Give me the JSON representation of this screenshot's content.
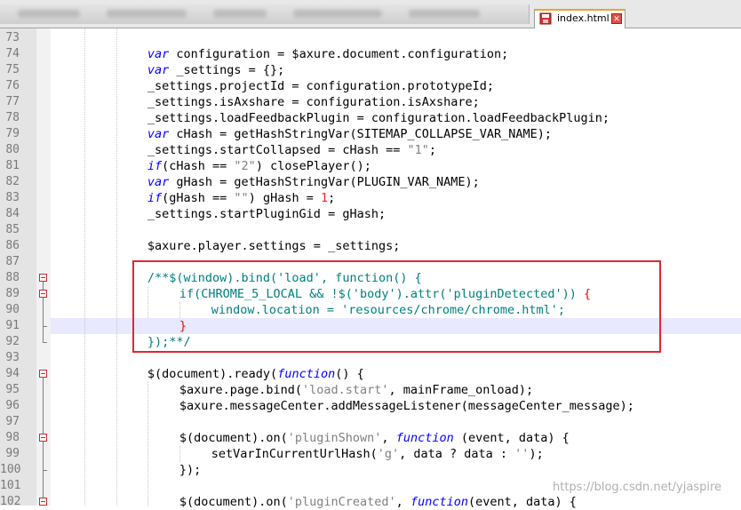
{
  "tab": {
    "filename": "index.html",
    "close_symbol": "✕"
  },
  "editor": {
    "lines": [
      {
        "num": "73",
        "indent": 0,
        "tokens": []
      },
      {
        "num": "74",
        "indent": 12,
        "tokens": [
          {
            "t": "var",
            "c": "kw"
          },
          {
            "t": " configuration = $axure.document.configuration;"
          }
        ]
      },
      {
        "num": "75",
        "indent": 12,
        "tokens": [
          {
            "t": "var",
            "c": "kw"
          },
          {
            "t": " _settings = {};"
          }
        ]
      },
      {
        "num": "76",
        "indent": 12,
        "tokens": [
          {
            "t": "_settings.projectId = configuration.prototypeId;"
          }
        ]
      },
      {
        "num": "77",
        "indent": 12,
        "tokens": [
          {
            "t": "_settings.isAxshare = configuration.isAxshare;"
          }
        ]
      },
      {
        "num": "78",
        "indent": 12,
        "tokens": [
          {
            "t": "_settings.loadFeedbackPlugin = configuration.loadFeedbackPlugin;"
          }
        ]
      },
      {
        "num": "79",
        "indent": 12,
        "tokens": [
          {
            "t": "var",
            "c": "kw"
          },
          {
            "t": " cHash = getHashStringVar(SITEMAP_COLLAPSE_VAR_NAME);"
          }
        ]
      },
      {
        "num": "80",
        "indent": 12,
        "tokens": [
          {
            "t": "_settings.startCollapsed = cHash == "
          },
          {
            "t": "\"1\"",
            "c": "str"
          },
          {
            "t": ";"
          }
        ]
      },
      {
        "num": "81",
        "indent": 12,
        "tokens": [
          {
            "t": "if",
            "c": "kw"
          },
          {
            "t": "(cHash == "
          },
          {
            "t": "\"2\"",
            "c": "str"
          },
          {
            "t": ") closePlayer();"
          }
        ]
      },
      {
        "num": "82",
        "indent": 12,
        "tokens": [
          {
            "t": "var",
            "c": "kw"
          },
          {
            "t": " gHash = getHashStringVar(PLUGIN_VAR_NAME);"
          }
        ]
      },
      {
        "num": "83",
        "indent": 12,
        "tokens": [
          {
            "t": "if",
            "c": "kw"
          },
          {
            "t": "(gHash == "
          },
          {
            "t": "\"\"",
            "c": "str"
          },
          {
            "t": ") gHash = "
          },
          {
            "t": "1",
            "c": "num"
          },
          {
            "t": ";"
          }
        ]
      },
      {
        "num": "84",
        "indent": 12,
        "tokens": [
          {
            "t": "_settings.startPluginGid = gHash;"
          }
        ]
      },
      {
        "num": "85",
        "indent": 0,
        "tokens": []
      },
      {
        "num": "86",
        "indent": 12,
        "tokens": [
          {
            "t": "$axure.player.settings = _settings;"
          }
        ]
      },
      {
        "num": "87",
        "indent": 0,
        "tokens": []
      },
      {
        "num": "88",
        "indent": 12,
        "tokens": [
          {
            "t": "/**$(window).bind('load', function() {",
            "c": "cmt"
          }
        ]
      },
      {
        "num": "89",
        "indent": 16,
        "tokens": [
          {
            "t": "if(CHROME_5_LOCAL && !$('body').attr('pluginDetected')) ",
            "c": "cmt"
          },
          {
            "t": "{",
            "c": "redbrace"
          }
        ]
      },
      {
        "num": "90",
        "indent": 20,
        "tokens": [
          {
            "t": "window.location = 'resources/chrome/chrome.html';",
            "c": "cmt"
          }
        ]
      },
      {
        "num": "91",
        "indent": 16,
        "tokens": [
          {
            "t": "}",
            "c": "redbrace"
          }
        ]
      },
      {
        "num": "92",
        "indent": 12,
        "tokens": [
          {
            "t": "});**/",
            "c": "cmt"
          }
        ]
      },
      {
        "num": "93",
        "indent": 0,
        "tokens": []
      },
      {
        "num": "94",
        "indent": 12,
        "tokens": [
          {
            "t": "$(document).ready("
          },
          {
            "t": "function",
            "c": "kw"
          },
          {
            "t": "() {"
          }
        ]
      },
      {
        "num": "95",
        "indent": 16,
        "tokens": [
          {
            "t": "$axure.page.bind("
          },
          {
            "t": "'load.start'",
            "c": "str"
          },
          {
            "t": ", mainFrame_onload);"
          }
        ]
      },
      {
        "num": "96",
        "indent": 16,
        "tokens": [
          {
            "t": "$axure.messageCenter.addMessageListener(messageCenter_message);"
          }
        ]
      },
      {
        "num": "97",
        "indent": 0,
        "tokens": []
      },
      {
        "num": "98",
        "indent": 16,
        "tokens": [
          {
            "t": "$(document).on("
          },
          {
            "t": "'pluginShown'",
            "c": "str"
          },
          {
            "t": ", "
          },
          {
            "t": "function",
            "c": "kw"
          },
          {
            "t": " (event, data) {"
          }
        ]
      },
      {
        "num": "99",
        "indent": 20,
        "tokens": [
          {
            "t": "setVarInCurrentUrlHash("
          },
          {
            "t": "'g'",
            "c": "str"
          },
          {
            "t": ", data ? data : "
          },
          {
            "t": "''",
            "c": "str"
          },
          {
            "t": ");"
          }
        ]
      },
      {
        "num": "100",
        "indent": 16,
        "tokens": [
          {
            "t": "});"
          }
        ]
      },
      {
        "num": "101",
        "indent": 0,
        "tokens": []
      },
      {
        "num": "102",
        "indent": 16,
        "tokens": [
          {
            "t": "$(document).on("
          },
          {
            "t": "'pluginCreated'",
            "c": "str"
          },
          {
            "t": ", "
          },
          {
            "t": "function",
            "c": "kw"
          },
          {
            "t": "(event, data) {"
          }
        ]
      }
    ]
  },
  "watermark": "https://blog.csdn.net/yjaspire"
}
